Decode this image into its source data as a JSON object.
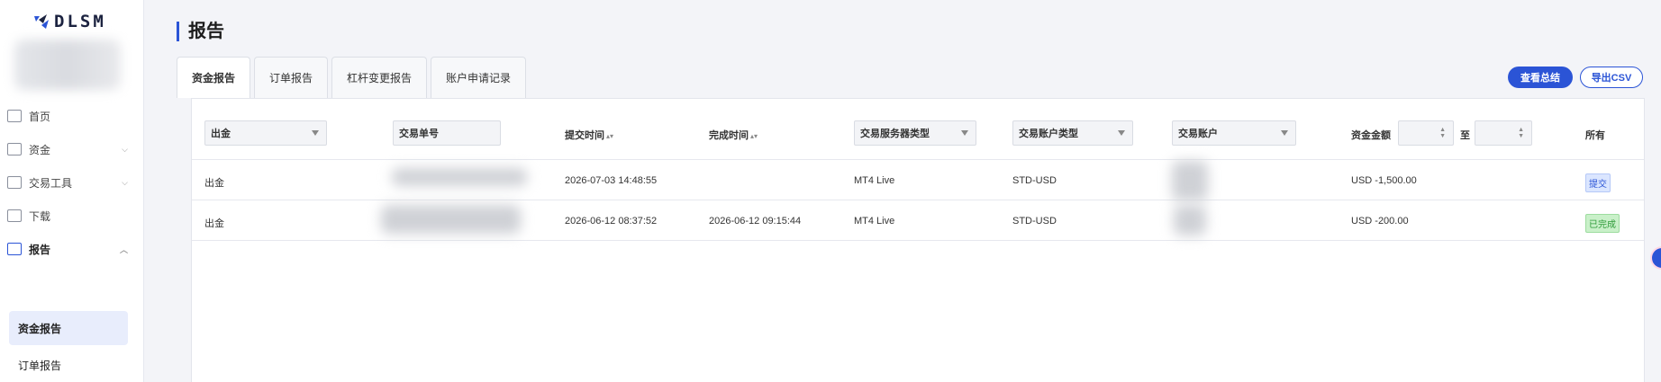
{
  "sidebar": {
    "logo_text": "DLSM",
    "nav": [
      {
        "label": "首页",
        "icon": "home-icon"
      },
      {
        "label": "资金",
        "icon": "wallet-icon"
      },
      {
        "label": "交易工具",
        "icon": "tools-icon"
      },
      {
        "label": "下载",
        "icon": "download-icon"
      },
      {
        "label": "报告",
        "icon": "report-icon"
      }
    ],
    "sub_items": [
      "资金报告",
      "订单报告"
    ]
  },
  "page": {
    "title": "报告"
  },
  "tabs": [
    "资金报告",
    "订单报告",
    "杠杆变更报告",
    "账户申请记录"
  ],
  "actions": {
    "summary": "查看总结",
    "export": "导出CSV"
  },
  "filters": {
    "type": "出金",
    "order_no": "交易单号",
    "server_type": "交易服务器类型",
    "account_type": "交易账户类型",
    "account": "交易账户",
    "amount_label": "资金金额",
    "range_sep": "至",
    "status": "所有"
  },
  "headers": {
    "submit_time": "提交时间",
    "complete_time": "完成时间"
  },
  "rows": [
    {
      "type": "出金",
      "submit_time": "2026-07-03 14:48:55",
      "complete_time": "",
      "server": "MT4 Live",
      "acct_type": "STD-USD",
      "amount": "USD -1,500.00",
      "status": "提交"
    },
    {
      "type": "出金",
      "submit_time": "2026-06-12 08:37:52",
      "complete_time": "2026-06-12 09:15:44",
      "server": "MT4 Live",
      "acct_type": "STD-USD",
      "amount": "USD -200.00",
      "status": "已完成"
    }
  ],
  "colors": {
    "accent": "#2b54d6",
    "status_submit": "#2b54d6",
    "status_done": "#2f9b3a"
  }
}
